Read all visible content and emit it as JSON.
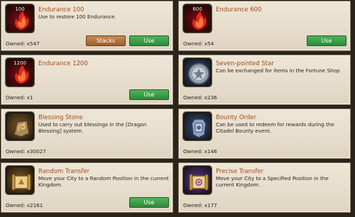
{
  "items": [
    {
      "title": "Endurance 100",
      "qty": "100",
      "desc": "Use to restore 100 Endurance.",
      "owned": "Owned: x547",
      "stacks_label": "Stacks",
      "use_label": "Use",
      "icon": "flame-icon"
    },
    {
      "title": "Endurance 600",
      "qty": "600",
      "desc": "",
      "owned": "Owned: x54",
      "use_label": "Use",
      "icon": "flame-icon"
    },
    {
      "title": "Endurance 1200",
      "qty": "1200",
      "desc": "",
      "owned": "Owned: x1",
      "use_label": "Use",
      "icon": "flame-icon"
    },
    {
      "title": "Seven-pointed Star",
      "desc": "Can be exchanged for items in the Fortune Shop",
      "owned": "Owned: x236",
      "icon": "star-medal-icon"
    },
    {
      "title": "Blessing Stone",
      "desc": "Used to carry out blessings in the [Dragon Blessing] system.",
      "owned": "Owned: x30027",
      "icon": "dragon-stone-icon"
    },
    {
      "title": "Bounty Order",
      "desc": "Can be used to redeem for rewards during the Citadel Bounty event.",
      "owned": "Owned: x146",
      "icon": "bounty-order-icon"
    },
    {
      "title": "Random Transfer",
      "desc": "Move your City to a Random Position in the current Kingdom.",
      "owned": "Owned: x2161",
      "use_label": "Use",
      "icon": "scroll-icon"
    },
    {
      "title": "Precise Transfer",
      "desc": "Move your City to a Specified Position in the current Kingdom.",
      "owned": "Owned: x177",
      "icon": "scroll-icon"
    }
  ]
}
